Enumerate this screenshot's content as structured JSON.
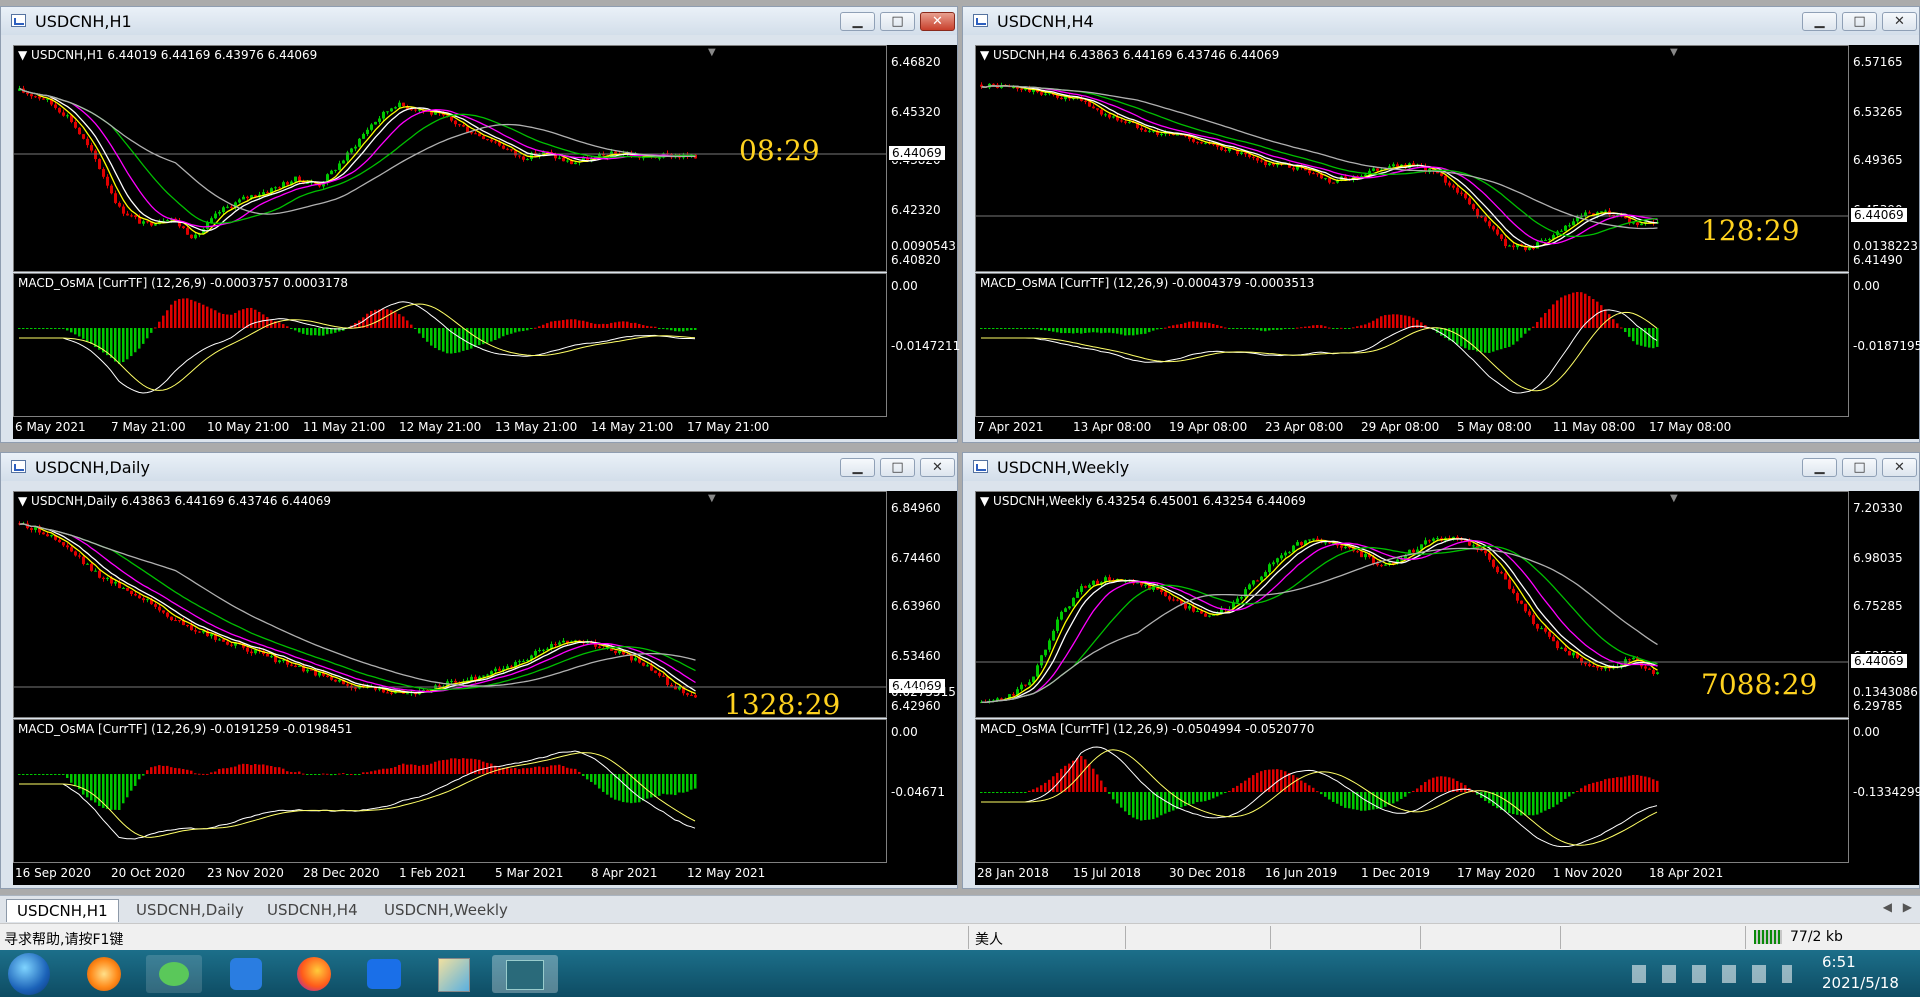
{
  "windows": [
    {
      "id": "h1",
      "title": "USDCNH,H1",
      "info": "USDCNH,H1  6.44019 6.44169 6.43976 6.44069",
      "macd": "MACD_OsMA [CurrTF] (12,26,9) -0.0003757 0.0003178",
      "timer": "08:29",
      "prices": [
        "6.46820",
        "6.45320",
        "6.43820",
        "6.42320",
        "6.40820"
      ],
      "current": "6.44069",
      "macd_ticks": [
        "0.0090543",
        "0.00",
        "-0.0147211"
      ],
      "dates": [
        "6 May 2021",
        "7 May 21:00",
        "10 May 21:00",
        "11 May 21:00",
        "12 May 21:00",
        "13 May 21:00",
        "14 May 21:00",
        "17 May 21:00"
      ]
    },
    {
      "id": "h4",
      "title": "USDCNH,H4",
      "info": "USDCNH,H4  6.43863 6.44169 6.43746 6.44069",
      "macd": "MACD_OsMA [CurrTF] (12,26,9) -0.0004379 -0.0003513",
      "timer": "128:29",
      "prices": [
        "6.57165",
        "6.53265",
        "6.49365",
        "6.45390",
        "6.41490"
      ],
      "current": "6.44069",
      "macd_ticks": [
        "0.0138223",
        "0.00",
        "-0.0187195"
      ],
      "dates": [
        "7 Apr 2021",
        "13 Apr 08:00",
        "19 Apr 08:00",
        "23 Apr 08:00",
        "29 Apr 08:00",
        "5 May 08:00",
        "11 May 08:00",
        "17 May 08:00"
      ]
    },
    {
      "id": "daily",
      "title": "USDCNH,Daily",
      "info": "USDCNH,Daily  6.43863 6.44169 6.43746 6.44069",
      "macd": "MACD_OsMA [CurrTF] (12,26,9) -0.0191259 -0.0198451",
      "timer": "1328:29",
      "prices": [
        "6.84960",
        "6.74460",
        "6.63960",
        "6.53460",
        "6.42960"
      ],
      "current": "6.44069",
      "macd_ticks": [
        "0.0275515",
        "0.00",
        "-0.04671"
      ],
      "dates": [
        "16 Sep 2020",
        "20 Oct 2020",
        "23 Nov 2020",
        "28 Dec 2020",
        "1 Feb 2021",
        "5 Mar 2021",
        "8 Apr 2021",
        "12 May 2021"
      ]
    },
    {
      "id": "weekly",
      "title": "USDCNH,Weekly",
      "info": "USDCNH,Weekly  6.43254 6.45001 6.43254 6.44069",
      "macd": "MACD_OsMA [CurrTF] (12,26,9) -0.0504994 -0.0520770",
      "timer": "7088:29",
      "prices": [
        "7.20330",
        "6.98035",
        "6.75285",
        "6.52535",
        "6.29785"
      ],
      "current": "6.44069",
      "macd_ticks": [
        "0.1343086",
        "0.00",
        "-0.1334299"
      ],
      "dates": [
        "28 Jan 2018",
        "15 Jul 2018",
        "30 Dec 2018",
        "16 Jun 2019",
        "1 Dec 2019",
        "17 May 2020",
        "1 Nov 2020",
        "18 Apr 2021"
      ]
    }
  ],
  "tabs": [
    "USDCNH,H1",
    "USDCNH,Daily",
    "USDCNH,H4",
    "USDCNH,Weekly"
  ],
  "status": {
    "help": "寻求帮助,请按F1键",
    "profile": "美人",
    "traffic": "77/2 kb"
  },
  "taskbar": {
    "time": "6:51",
    "date": "2021/5/18"
  },
  "icons": [
    "windows-start-icon",
    "browser-icon",
    "wechat-icon",
    "lark-icon",
    "firefox-icon",
    "meitu-icon",
    "paint-icon",
    "mt4-icon"
  ],
  "colors": {
    "bull": "#00c800",
    "bear": "#e00000",
    "ma_fast": "#ffff00",
    "ma_white": "#ffffff",
    "ma_magenta": "#ff00ff",
    "ma_green": "#00c000",
    "ma_gray": "#b0b0b0",
    "timer": "#ffd21f"
  },
  "chart_data": [
    {
      "type": "candlestick",
      "series_name": "USDCNH,H1",
      "x_ticks": [
        "6 May 2021",
        "7 May 21:00",
        "10 May 21:00",
        "11 May 21:00",
        "12 May 21:00",
        "13 May 21:00",
        "14 May 21:00",
        "17 May 21:00"
      ],
      "ylim": [
        6.4,
        6.475
      ],
      "close": [
        6.465,
        6.462,
        6.455,
        6.44,
        6.421,
        6.415,
        6.418,
        6.41,
        6.42,
        6.425,
        6.428,
        6.432,
        6.43,
        6.44,
        6.452,
        6.46,
        6.458,
        6.455,
        6.45,
        6.446,
        6.44,
        6.442,
        6.438,
        6.44,
        6.442,
        6.44,
        6.441,
        6.44
      ]
    },
    {
      "type": "candlestick",
      "series_name": "USDCNH,H4",
      "x_ticks": [
        "7 Apr 2021",
        "13 Apr 08:00",
        "19 Apr 08:00",
        "23 Apr 08:00",
        "29 Apr 08:00",
        "5 May 08:00",
        "11 May 08:00",
        "17 May 08:00"
      ],
      "ylim": [
        6.405,
        6.58
      ],
      "close": [
        6.562,
        6.56,
        6.557,
        6.552,
        6.548,
        6.535,
        6.528,
        6.52,
        6.518,
        6.51,
        6.505,
        6.495,
        6.492,
        6.488,
        6.478,
        6.482,
        6.49,
        6.492,
        6.487,
        6.47,
        6.445,
        6.422,
        6.42,
        6.432,
        6.448,
        6.45,
        6.441,
        6.44
      ]
    },
    {
      "type": "candlestick",
      "series_name": "USDCNH,Daily",
      "x_ticks": [
        "16 Sep 2020",
        "20 Oct 2020",
        "23 Nov 2020",
        "28 Dec 2020",
        "1 Feb 2021",
        "5 Mar 2021",
        "8 Apr 2021",
        "12 May 2021"
      ],
      "ylim": [
        6.41,
        6.86
      ],
      "close": [
        6.83,
        6.81,
        6.77,
        6.72,
        6.69,
        6.66,
        6.62,
        6.59,
        6.57,
        6.55,
        6.53,
        6.51,
        6.49,
        6.47,
        6.46,
        6.455,
        6.45,
        6.47,
        6.48,
        6.5,
        6.52,
        6.55,
        6.57,
        6.56,
        6.54,
        6.51,
        6.47,
        6.441
      ]
    },
    {
      "type": "candlestick",
      "series_name": "USDCNH,Weekly",
      "x_ticks": [
        "28 Jan 2018",
        "15 Jul 2018",
        "30 Dec 2018",
        "16 Jun 2019",
        "1 Dec 2019",
        "17 May 2020",
        "1 Nov 2020",
        "18 Apr 2021"
      ],
      "ylim": [
        6.27,
        7.23
      ],
      "close": [
        6.31,
        6.33,
        6.42,
        6.7,
        6.86,
        6.9,
        6.88,
        6.85,
        6.78,
        6.72,
        6.77,
        6.9,
        7.02,
        7.09,
        7.07,
        7.03,
        6.96,
        7.02,
        7.1,
        7.09,
        7.03,
        6.88,
        6.7,
        6.58,
        6.51,
        6.47,
        6.52,
        6.441
      ]
    }
  ]
}
